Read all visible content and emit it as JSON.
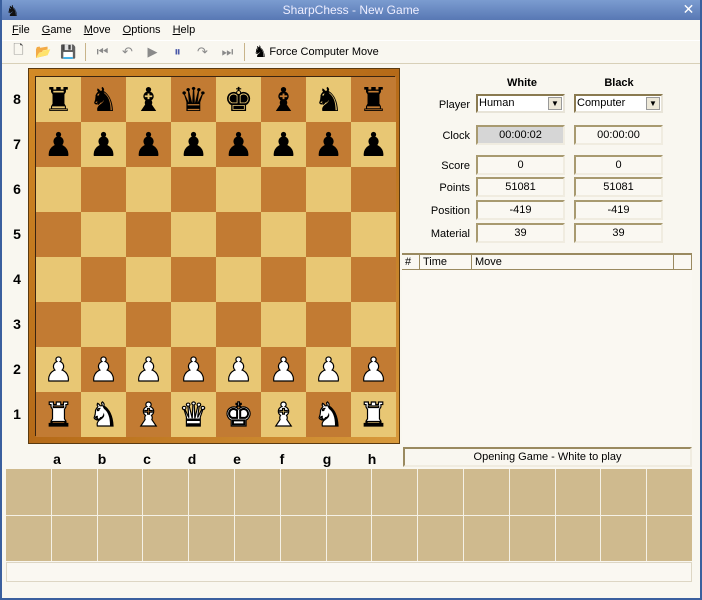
{
  "window": {
    "title": "SharpChess - New Game"
  },
  "menu": [
    "File",
    "Game",
    "Move",
    "Options",
    "Help"
  ],
  "toolbar": {
    "force_label": "Force Computer Move"
  },
  "board": {
    "rows": [
      "rnbqkbnr",
      "pppppppp",
      "........",
      "........",
      "........",
      "........",
      "PPPPPPPP",
      "RNBQKBNR"
    ],
    "ranks": [
      "8",
      "7",
      "6",
      "5",
      "4",
      "3",
      "2",
      "1"
    ],
    "files": [
      "a",
      "b",
      "c",
      "d",
      "e",
      "f",
      "g",
      "h"
    ]
  },
  "panel": {
    "white_header": "White",
    "black_header": "Black",
    "labels": {
      "player": "Player",
      "clock": "Clock",
      "score": "Score",
      "points": "Points",
      "position": "Position",
      "material": "Material"
    },
    "white": {
      "player": "Human",
      "clock": "00:00:02",
      "score": "0",
      "points": "51081",
      "position": "-419",
      "material": "39"
    },
    "black": {
      "player": "Computer",
      "clock": "00:00:00",
      "score": "0",
      "points": "51081",
      "position": "-419",
      "material": "39"
    }
  },
  "moves": {
    "columns": [
      "#",
      "Time",
      "Move"
    ]
  },
  "status": "Opening Game - White to play"
}
